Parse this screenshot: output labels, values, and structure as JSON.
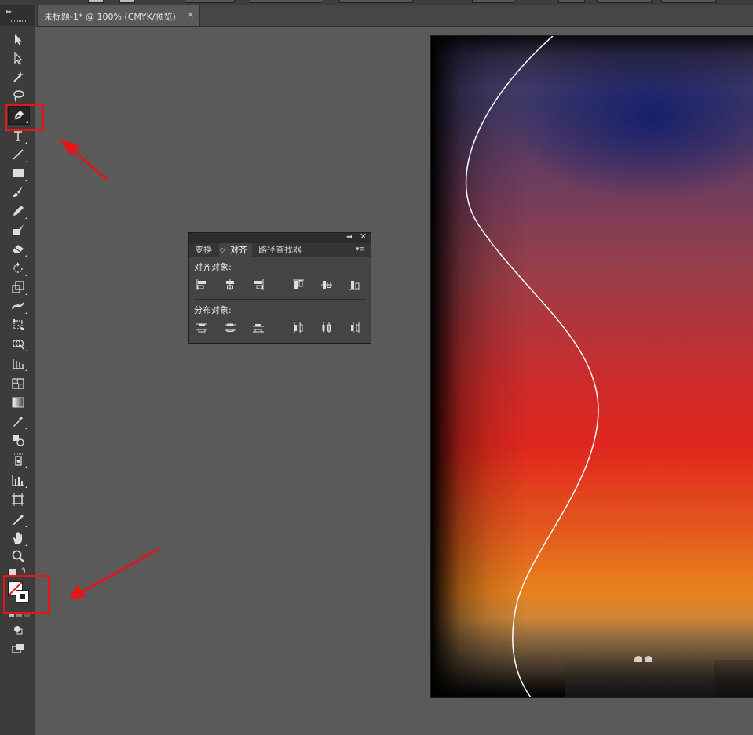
{
  "document": {
    "tab_label": "未标题-1* @ 100% (CMYK/预览)",
    "close_glyph": "×"
  },
  "tools_panel": {
    "collapse_glyph": "▸▸",
    "tools": [
      {
        "name": "selection-tool",
        "icon": "arrow-icon"
      },
      {
        "name": "direct-selection-tool",
        "icon": "hollow-arrow-icon"
      },
      {
        "name": "magic-wand-tool",
        "icon": "magic-wand-icon"
      },
      {
        "name": "lasso-tool",
        "icon": "lasso-icon"
      },
      {
        "name": "pen-tool",
        "icon": "pen-icon",
        "highlighted": true
      },
      {
        "name": "type-tool",
        "icon": "type-icon"
      },
      {
        "name": "line-segment-tool",
        "icon": "line-icon"
      },
      {
        "name": "rectangle-tool",
        "icon": "rectangle-icon"
      },
      {
        "name": "paintbrush-tool",
        "icon": "brush-icon"
      },
      {
        "name": "pencil-tool",
        "icon": "pencil-icon"
      },
      {
        "name": "blob-brush-tool",
        "icon": "blob-brush-icon"
      },
      {
        "name": "eraser-tool",
        "icon": "eraser-icon"
      },
      {
        "name": "rotate-tool",
        "icon": "rotate-icon"
      },
      {
        "name": "scale-tool",
        "icon": "scale-icon"
      },
      {
        "name": "width-tool",
        "icon": "width-icon"
      },
      {
        "name": "free-transform-tool",
        "icon": "free-transform-icon"
      },
      {
        "name": "shape-builder-tool",
        "icon": "shape-builder-icon"
      },
      {
        "name": "perspective-grid-tool",
        "icon": "perspective-grid-icon"
      },
      {
        "name": "mesh-tool",
        "icon": "mesh-icon"
      },
      {
        "name": "gradient-tool",
        "icon": "gradient-icon"
      },
      {
        "name": "eyedropper-tool",
        "icon": "eyedropper-icon"
      },
      {
        "name": "blend-tool",
        "icon": "blend-icon"
      },
      {
        "name": "symbol-sprayer-tool",
        "icon": "symbol-sprayer-icon"
      },
      {
        "name": "column-graph-tool",
        "icon": "column-graph-icon"
      },
      {
        "name": "artboard-tool",
        "icon": "artboard-icon"
      },
      {
        "name": "slice-tool",
        "icon": "slice-icon"
      },
      {
        "name": "hand-tool",
        "icon": "hand-icon"
      },
      {
        "name": "zoom-tool",
        "icon": "magnifier-icon"
      }
    ],
    "fill_stroke": {
      "fill": "none",
      "stroke": "#ffffff",
      "highlighted": true
    }
  },
  "align_panel": {
    "collapse_glyph": "◂◂",
    "close_glyph": "✕",
    "tabs": [
      {
        "label": "变换",
        "active": false
      },
      {
        "label": "对齐",
        "active": true
      },
      {
        "label": "路径查找器",
        "active": false
      }
    ],
    "tab_arrows_glyph": "◇",
    "menu_glyph": "▾≡",
    "align_objects_label": "对齐对象:",
    "align_buttons": [
      "align-left",
      "align-horizontal-center",
      "align-right",
      "align-top",
      "align-vertical-center",
      "align-bottom"
    ],
    "distribute_objects_label": "分布对象:",
    "distribute_buttons": [
      "distribute-top",
      "distribute-vertical-center",
      "distribute-bottom",
      "distribute-left",
      "distribute-horizontal-center",
      "distribute-right"
    ]
  },
  "annotations": {
    "color": "#e4161c",
    "arrows": 2,
    "highlight_boxes": 2
  },
  "artboard": {
    "colors": {
      "top": "#16206b",
      "middle": "#e0261d",
      "lower": "#e8821e",
      "curve": "#ffffff"
    }
  }
}
